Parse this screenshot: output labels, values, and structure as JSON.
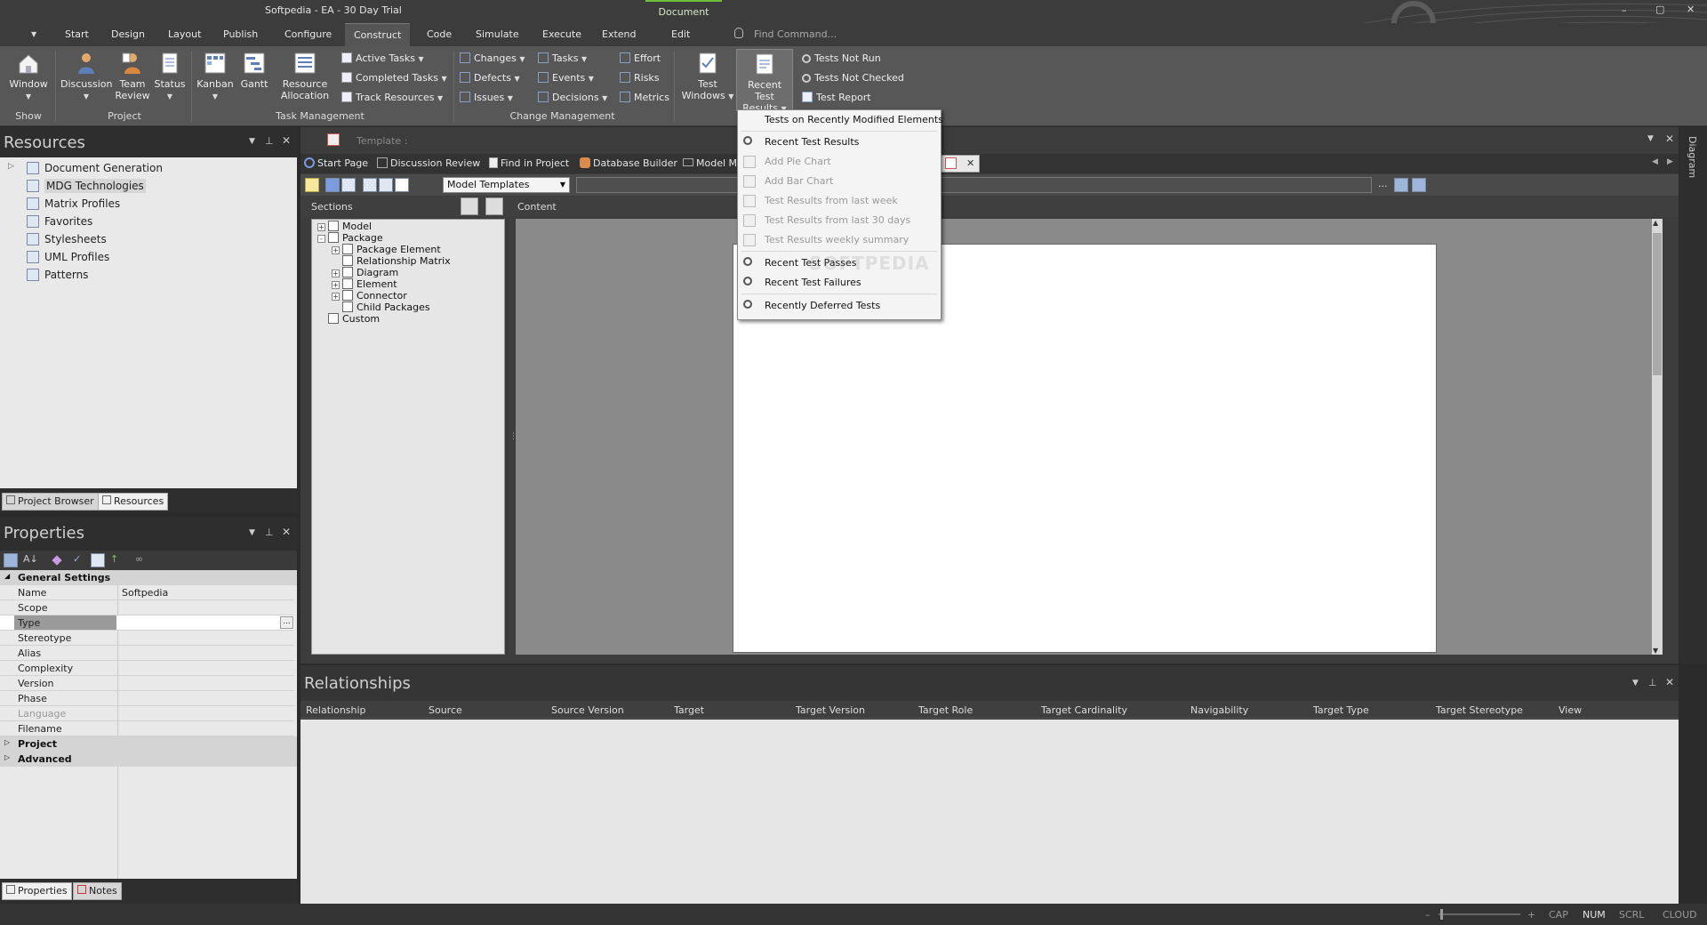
{
  "window": {
    "title": "Softpedia - EA - 30 Day Trial",
    "context_tab": "Document",
    "find_command_placeholder": "Find Command...",
    "min_glyph": "–",
    "max_glyph": "▢",
    "close_glyph": "✕"
  },
  "menu": {
    "tabs": [
      "Start",
      "Design",
      "Layout",
      "Publish",
      "Configure",
      "Construct",
      "Code",
      "Simulate",
      "Execute",
      "Extend",
      "Edit"
    ],
    "active": "Construct"
  },
  "ribbon": {
    "show": {
      "window": "Window",
      "group": "Show"
    },
    "project": {
      "discussion": "Discussion",
      "team_review_1": "Team",
      "team_review_2": "Review",
      "status": "Status",
      "group": "Project"
    },
    "task_management": {
      "kanban": "Kanban",
      "gantt": "Gantt",
      "resource_1": "Resource",
      "resource_2": "Allocation",
      "active_tasks": "Active Tasks",
      "completed_tasks": "Completed Tasks",
      "track_resources": "Track Resources",
      "group": "Task Management"
    },
    "change_management": {
      "changes": "Changes",
      "defects": "Defects",
      "issues": "Issues",
      "tasks": "Tasks",
      "events": "Events",
      "decisions": "Decisions",
      "effort": "Effort",
      "risks": "Risks",
      "metrics": "Metrics",
      "group": "Change Management"
    },
    "testing": {
      "test_windows_1": "Test",
      "test_windows_2": "Windows",
      "recent_1": "Recent Test",
      "recent_2": "Results",
      "tests_not_run": "Tests Not Run",
      "tests_not_checked": "Tests Not Checked",
      "test_report": "Test Report"
    }
  },
  "dropdown": {
    "items": [
      {
        "label": "Tests on Recently Modified Elements",
        "disabled": false,
        "icon": "none"
      },
      {
        "label": "Recent Test Results",
        "disabled": false,
        "icon": "search-icon"
      },
      {
        "label": "Add Pie Chart",
        "disabled": true,
        "icon": "doc-icon"
      },
      {
        "label": "Add Bar Chart",
        "disabled": true,
        "icon": "doc-icon"
      },
      {
        "label": "Test Results from last week",
        "disabled": true,
        "icon": "doc-icon"
      },
      {
        "label": "Test Results from last 30 days",
        "disabled": true,
        "icon": "doc-icon"
      },
      {
        "label": "Test Results weekly summary",
        "disabled": true,
        "icon": "doc-icon"
      },
      {
        "label": "Recent Test Passes",
        "disabled": false,
        "icon": "search-icon"
      },
      {
        "label": "Recent Test Failures",
        "disabled": false,
        "icon": "search-icon"
      },
      {
        "label": "Recently Deferred Tests",
        "disabled": false,
        "icon": "search-icon"
      }
    ]
  },
  "resources": {
    "title": "Resources",
    "items": [
      "Document Generation",
      "MDG Technologies",
      "Matrix Profiles",
      "Favorites",
      "Stylesheets",
      "UML Profiles",
      "Patterns"
    ],
    "selected": "MDG Technologies",
    "bottom_tabs": [
      "Project Browser",
      "Resources"
    ]
  },
  "properties": {
    "title": "Properties",
    "section": "General Settings",
    "rows": [
      {
        "key": "Name",
        "value": "Softpedia"
      },
      {
        "key": "Scope",
        "value": ""
      },
      {
        "key": "Type",
        "value": ""
      },
      {
        "key": "Stereotype",
        "value": ""
      },
      {
        "key": "Alias",
        "value": ""
      },
      {
        "key": "Complexity",
        "value": ""
      },
      {
        "key": "Version",
        "value": ""
      },
      {
        "key": "Phase",
        "value": ""
      },
      {
        "key": "Language",
        "value": ""
      },
      {
        "key": "Filename",
        "value": ""
      }
    ],
    "collapsed_sections": [
      "Project",
      "Advanced"
    ],
    "bottom_tabs": [
      "Properties",
      "Notes"
    ],
    "ellipsis": "..."
  },
  "document": {
    "template_label": "Template :",
    "tabs": [
      "Start Page",
      "Discussion Review",
      "Find in Project",
      "Database Builder",
      "Model M"
    ],
    "template_select": "Model Templates",
    "sections_label": "Sections",
    "content_label": "Content",
    "tree": [
      {
        "label": "Model",
        "level": 0,
        "expander": "+"
      },
      {
        "label": "Package",
        "level": 0,
        "expander": "-"
      },
      {
        "label": "Package Element",
        "level": 1,
        "expander": "+"
      },
      {
        "label": "Relationship Matrix",
        "level": 1,
        "expander": ""
      },
      {
        "label": "Diagram",
        "level": 1,
        "expander": "+"
      },
      {
        "label": "Element",
        "level": 1,
        "expander": "+"
      },
      {
        "label": "Connector",
        "level": 1,
        "expander": "+"
      },
      {
        "label": "Child Packages",
        "level": 1,
        "expander": ""
      },
      {
        "label": "Custom",
        "level": 0,
        "expander": ""
      }
    ],
    "ellipsis": "...",
    "watermark": "SOFTPEDIA",
    "side_tab": "Diagram"
  },
  "relationships": {
    "title": "Relationships",
    "columns": [
      "Relationship",
      "Source",
      "Source Version",
      "Target",
      "Target Version",
      "Target Role",
      "Target Cardinality",
      "Navigability",
      "Target Type",
      "Target Stereotype",
      "View"
    ]
  },
  "statusbar": {
    "minus": "–",
    "plus": "+",
    "indicators": [
      "CAP",
      "NUM",
      "SCRL",
      "CLOUD"
    ],
    "active": "NUM"
  },
  "colors": {
    "accent": "#6fbf3a",
    "ribbon": "#575757",
    "panel": "#e9e9e9",
    "dark": "#2b2b2b"
  }
}
